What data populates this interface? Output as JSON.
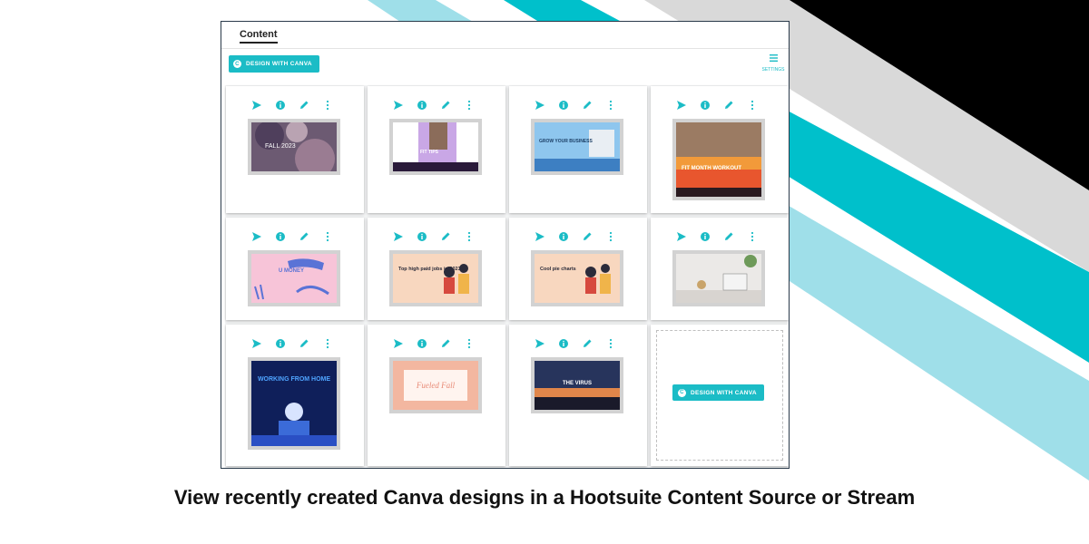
{
  "colors": {
    "accent": "#1bbcc6",
    "stripe_light": "#9fdfe9",
    "stripe_teal": "#00c0cb",
    "stripe_gray": "#d9d9d9",
    "stripe_black": "#000000"
  },
  "window": {
    "tab_label": "Content",
    "toolbar": {
      "canva_button_label": "DESIGN WITH CANVA",
      "settings_label": "SETTINGS",
      "settings_icon": "menu-icon"
    }
  },
  "card_actions": [
    "send-icon",
    "info-icon",
    "edit-icon",
    "more-icon"
  ],
  "designs": [
    {
      "text": "FALL 2023",
      "theme": "watercolor purple"
    },
    {
      "text": "FIT TIPS",
      "theme": "fitness purple"
    },
    {
      "text": "GROW YOUR BUSINESS",
      "theme": "blue office"
    },
    {
      "text": "FIT MONTH WORKOUT",
      "theme": "fitness orange"
    },
    {
      "text": "U MONEY",
      "theme": "pink brush"
    },
    {
      "text": "Top high paid jobs in 2023",
      "theme": "peach people"
    },
    {
      "text": "Cool pie charts",
      "theme": "peach people"
    },
    {
      "text": "",
      "theme": "desk laptop"
    },
    {
      "text": "WORKING FROM HOME",
      "theme": "navy illustration"
    },
    {
      "text": "Fueled Fall",
      "theme": "floral frame"
    },
    {
      "text": "THE VIRUS",
      "theme": "sunset"
    }
  ],
  "empty_card": {
    "canva_button_label": "DESIGN WITH CANVA"
  },
  "caption": "View recently created Canva designs in a Hootsuite Content Source or Stream"
}
